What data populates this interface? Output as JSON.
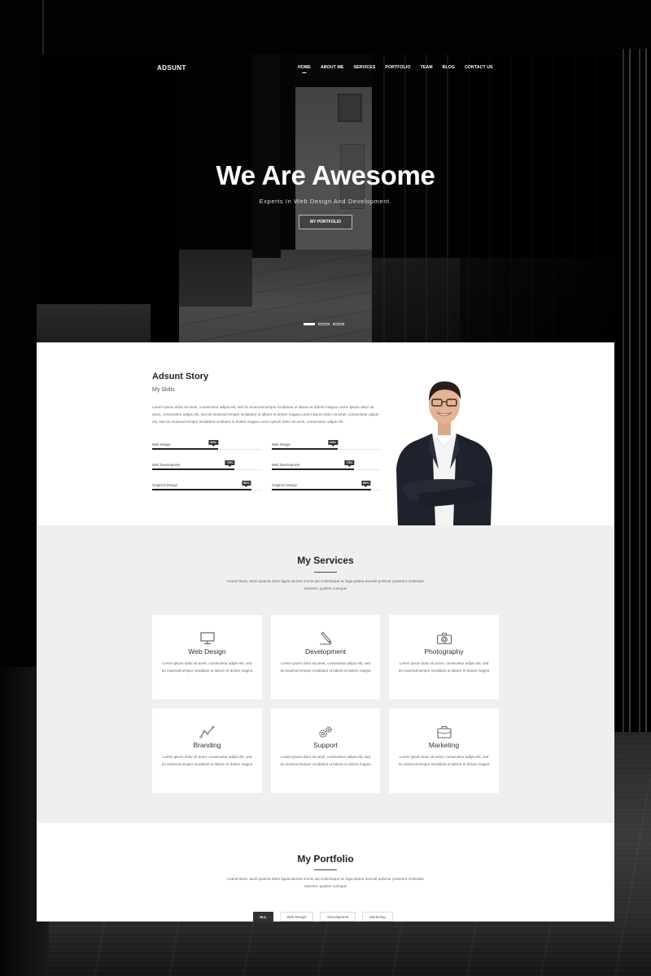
{
  "nav": {
    "brand": "ADSUNT",
    "items": [
      {
        "label": "HOME",
        "active": true
      },
      {
        "label": "ABOUT ME"
      },
      {
        "label": "SERVICES"
      },
      {
        "label": "PORTFOLIO"
      },
      {
        "label": "TEAM"
      },
      {
        "label": "BLOG"
      },
      {
        "label": "CONTACT US"
      }
    ]
  },
  "hero": {
    "title": "We Are Awesome",
    "subtitle": "Experts In Web Design And Development.",
    "button_label": "MY PORTFOLIO",
    "slides": 3,
    "active_slide": 1
  },
  "about": {
    "title": "Adsunt Story",
    "subtitle": "My Skills",
    "paragraph": "Lorem ipsum dolor sit amet, consectetur adipis elit, sed do eiusmod tempor incididunt ut labore et dolore magna Lorem ipsum dolor sit amet, consectetur adipis elit, sed do eiusmod tempor incididunt ut labore et dolore magna Lorem ipsum dolor sit amet, consectetur adipis elit, sed do eiusmod tempor incididunt ut labore et dolore magna Lorem ipsum dolor sit amet, consectetur adipis elit",
    "skills": [
      {
        "label": "Web Design",
        "value": 60,
        "value_label": "60%"
      },
      {
        "label": "Web Design",
        "value": 60,
        "value_label": "60%"
      },
      {
        "label": "Web Development",
        "value": 75,
        "value_label": "75%"
      },
      {
        "label": "Web Development",
        "value": 75,
        "value_label": "75%"
      },
      {
        "label": "Graphics Design",
        "value": 90,
        "value_label": "90%"
      },
      {
        "label": "Graphics Design",
        "value": 90,
        "value_label": "90%"
      }
    ]
  },
  "services": {
    "title": "My Services",
    "description": "Userat litora, taciti quaerat dolor ligula laoreet omnis aut scelerisque ex fuga platea eveniet pulvinar praesent molestiae maiores, quidem cumque!",
    "cards": [
      {
        "title": "Web Design",
        "icon": "monitor-icon",
        "text": "Lorem ipsum dolor sit amet, consectetur adipis elit, sed do eiusmod tempor incididunt ut labore et dolore magna"
      },
      {
        "title": "Development",
        "icon": "pencil-icon",
        "text": "Lorem ipsum dolor sit amet, consectetur adipis elit, sed do eiusmod tempor incididunt ut labore et dolore magna"
      },
      {
        "title": "Photography",
        "icon": "camera-icon",
        "text": "Lorem ipsum dolor sit amet, consectetur adipis elit, sed do eiusmod tempor incididunt ut labore et dolore magna"
      },
      {
        "title": "Branding",
        "icon": "chart-line-icon",
        "text": "Lorem ipsum dolor sit amet, consectetur adipis elit, sed do eiusmod tempor incididunt ut labore et dolore magna"
      },
      {
        "title": "Support",
        "icon": "gears-icon",
        "text": "Lorem ipsum dolor sit amet, consectetur adipis elit, sed do eiusmod tempor incididunt ut labore et dolore magna"
      },
      {
        "title": "Marketing",
        "icon": "briefcase-icon",
        "text": "Lorem ipsum dolor sit amet, consectetur adipis elit, sed do eiusmod tempor incididunt ut labore et dolore magna"
      }
    ]
  },
  "portfolio": {
    "title": "My Portfolio",
    "description": "Userat litora, taciti quaerat dolor ligula laoreet omnis aut scelerisque ex fuga platea eveniet pulvinar praesent molestiae maiores, quidem cumque!",
    "filters": [
      {
        "label": "ALL",
        "active": true
      },
      {
        "label": "Web Design"
      },
      {
        "label": "Development"
      },
      {
        "label": "Marketing"
      }
    ]
  }
}
